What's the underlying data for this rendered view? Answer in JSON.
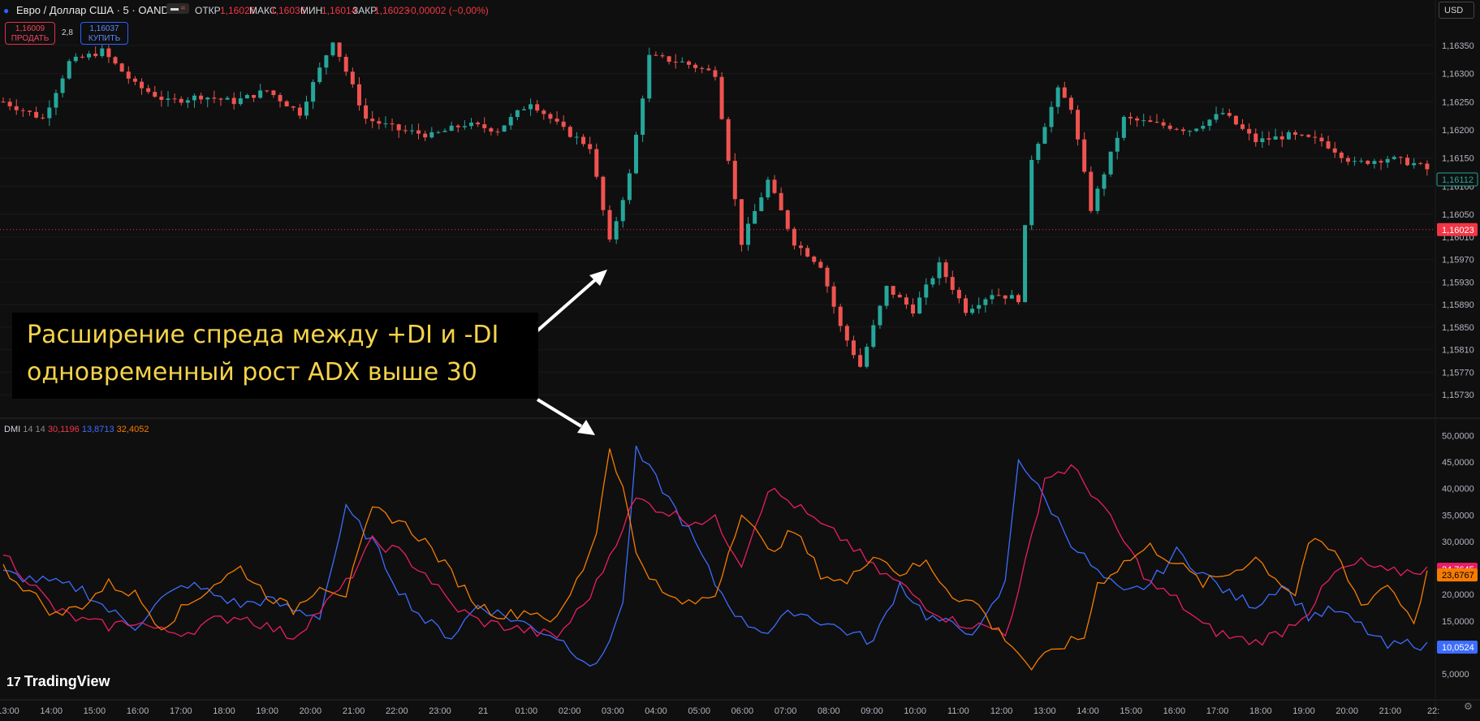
{
  "header": {
    "symbol": "Евро / Доллар США · 5 · OANDA",
    "open_label": "ОТКР",
    "open_value": "1,16026",
    "high_label": "МАКС",
    "high_value": "1,16036",
    "low_label": "МИН",
    "low_value": "1,16014",
    "close_label": "ЗАКР",
    "close_value": "1,16023",
    "change": "−0,00002 (−0,00%)"
  },
  "trade": {
    "sell_price": "1,16009",
    "sell_label": "ПРОДАТЬ",
    "spread": "2,8",
    "buy_price": "1,16037",
    "buy_label": "КУПИТЬ"
  },
  "currency": "USD",
  "annotation": {
    "line1": "Расширение спреда между +DI и -DI",
    "line2": "одновременный рост ADX выше 30"
  },
  "logo": "TradingView",
  "colors": {
    "up": "#26a69a",
    "down": "#ef5350",
    "plus_di": "#3d6cff",
    "minus_di": "#e91e63",
    "adx": "#f57c00",
    "current_price": "#f23645"
  },
  "chart_data": [
    {
      "type": "candlestick",
      "symbol": "EURUSD",
      "interval": "5",
      "x_ticks": [
        "13:00",
        "14:00",
        "15:00",
        "16:00",
        "17:00",
        "18:00",
        "19:00",
        "20:00",
        "21:00",
        "22:00",
        "23:00",
        "21",
        "01:00",
        "02:00",
        "03:00",
        "04:00",
        "05:00",
        "06:00",
        "07:00",
        "08:00",
        "09:00",
        "10:00",
        "11:00",
        "12:00",
        "13:00",
        "14:00",
        "15:00",
        "16:00",
        "17:00",
        "18:00",
        "19:00",
        "20:00",
        "21:00",
        "22:"
      ],
      "y_ticks": [
        "1,16350",
        "1,16300",
        "1,16250",
        "1,16200",
        "1,16150",
        "1,16100",
        "1,16050",
        "1,16010",
        "1,15970",
        "1,15930",
        "1,15890",
        "1,15850",
        "1,15810",
        "1,15770",
        "1,15730"
      ],
      "ylim": [
        1.1571,
        1.1637
      ],
      "price_path": [
        [
          0,
          1.1625
        ],
        [
          6,
          1.1622
        ],
        [
          10,
          1.1632
        ],
        [
          15,
          1.1634
        ],
        [
          20,
          1.1628
        ],
        [
          25,
          1.1625
        ],
        [
          30,
          1.1626
        ],
        [
          35,
          1.1625
        ],
        [
          40,
          1.1627
        ],
        [
          45,
          1.1623
        ],
        [
          50,
          1.1636
        ],
        [
          55,
          1.1622
        ],
        [
          60,
          1.162
        ],
        [
          65,
          1.1619
        ],
        [
          70,
          1.1621
        ],
        [
          75,
          1.162
        ],
        [
          80,
          1.1625
        ],
        [
          85,
          1.162
        ],
        [
          89,
          1.1617
        ],
        [
          92,
          1.16
        ],
        [
          95,
          1.1612
        ],
        [
          98,
          1.1633
        ],
        [
          103,
          1.1632
        ],
        [
          108,
          1.163
        ],
        [
          112,
          1.16
        ],
        [
          116,
          1.1611
        ],
        [
          120,
          1.16
        ],
        [
          124,
          1.1596
        ],
        [
          127,
          1.1585
        ],
        [
          130,
          1.1578
        ],
        [
          134,
          1.1592
        ],
        [
          138,
          1.1588
        ],
        [
          142,
          1.1596
        ],
        [
          146,
          1.1588
        ],
        [
          150,
          1.1591
        ],
        [
          154,
          1.159
        ],
        [
          156,
          1.1615
        ],
        [
          160,
          1.1627
        ],
        [
          162,
          1.1624
        ],
        [
          165,
          1.1606
        ],
        [
          170,
          1.1622
        ],
        [
          175,
          1.1621
        ],
        [
          180,
          1.162
        ],
        [
          185,
          1.1623
        ],
        [
          190,
          1.1618
        ],
        [
          195,
          1.1619
        ],
        [
          200,
          1.1618
        ],
        [
          205,
          1.1614
        ],
        [
          210,
          1.1615
        ],
        [
          214,
          1.1614
        ],
        [
          216,
          1.1613
        ]
      ],
      "last_close": "1,16112",
      "current_price": "1,16023"
    },
    {
      "type": "line",
      "name": "DMI 14 14",
      "legend": {
        "label": "DMI",
        "params": "14 14",
        "adx": "30,1196",
        "plus_di": "13,8713",
        "minus_di": "32,4052"
      },
      "y_ticks": [
        "50,0000",
        "45,0000",
        "40,0000",
        "35,0000",
        "30,0000",
        "25,0000",
        "20,0000",
        "15,0000",
        "5,0000"
      ],
      "ylim": [
        3,
        51
      ],
      "last_values": {
        "minus_di": "24,7645",
        "adx": "23,6767",
        "plus_di": "10,0524"
      },
      "series": [
        {
          "name": "+DI",
          "values": [
            [
              0,
              24
            ],
            [
              8,
              22
            ],
            [
              12,
              21
            ],
            [
              16,
              17
            ],
            [
              20,
              14
            ],
            [
              24,
              19
            ],
            [
              28,
              22
            ],
            [
              32,
              20
            ],
            [
              36,
              18
            ],
            [
              40,
              19
            ],
            [
              44,
              17
            ],
            [
              48,
              16
            ],
            [
              52,
              36
            ],
            [
              56,
              30
            ],
            [
              60,
              21
            ],
            [
              64,
              15
            ],
            [
              68,
              12
            ],
            [
              72,
              18
            ],
            [
              76,
              16
            ],
            [
              80,
              14
            ],
            [
              84,
              12
            ],
            [
              88,
              8
            ],
            [
              90,
              6
            ],
            [
              94,
              18
            ],
            [
              96,
              47
            ],
            [
              100,
              40
            ],
            [
              104,
              32
            ],
            [
              108,
              22
            ],
            [
              112,
              15
            ],
            [
              116,
              13
            ],
            [
              120,
              17
            ],
            [
              124,
              15
            ],
            [
              128,
              13
            ],
            [
              132,
              11
            ],
            [
              136,
              22
            ],
            [
              140,
              16
            ],
            [
              144,
              14
            ],
            [
              148,
              13
            ],
            [
              152,
              22
            ],
            [
              154,
              46
            ],
            [
              158,
              38
            ],
            [
              162,
              30
            ],
            [
              166,
              24
            ],
            [
              170,
              20
            ],
            [
              174,
              22
            ],
            [
              178,
              28
            ],
            [
              182,
              24
            ],
            [
              186,
              20
            ],
            [
              190,
              18
            ],
            [
              194,
              22
            ],
            [
              198,
              16
            ],
            [
              202,
              17
            ],
            [
              206,
              14
            ],
            [
              210,
              10
            ],
            [
              214,
              11
            ],
            [
              216,
              10
            ]
          ]
        },
        {
          "name": "-DI",
          "values": [
            [
              0,
              28
            ],
            [
              8,
              17
            ],
            [
              12,
              15
            ],
            [
              16,
              14
            ],
            [
              20,
              15
            ],
            [
              24,
              13
            ],
            [
              28,
              13
            ],
            [
              32,
              15
            ],
            [
              36,
              16
            ],
            [
              40,
              14
            ],
            [
              44,
              12
            ],
            [
              48,
              17
            ],
            [
              52,
              22
            ],
            [
              56,
              30
            ],
            [
              60,
              28
            ],
            [
              64,
              24
            ],
            [
              68,
              18
            ],
            [
              72,
              15
            ],
            [
              76,
              14
            ],
            [
              80,
              13
            ],
            [
              84,
              12
            ],
            [
              88,
              18
            ],
            [
              90,
              22
            ],
            [
              94,
              33
            ],
            [
              96,
              38
            ],
            [
              100,
              36
            ],
            [
              104,
              34
            ],
            [
              108,
              34
            ],
            [
              112,
              26
            ],
            [
              116,
              40
            ],
            [
              120,
              37
            ],
            [
              124,
              33
            ],
            [
              128,
              30
            ],
            [
              132,
              25
            ],
            [
              136,
              22
            ],
            [
              140,
              18
            ],
            [
              144,
              15
            ],
            [
              148,
              14
            ],
            [
              152,
              13
            ],
            [
              154,
              20
            ],
            [
              158,
              42
            ],
            [
              162,
              44
            ],
            [
              166,
              38
            ],
            [
              170,
              30
            ],
            [
              174,
              22
            ],
            [
              178,
              19
            ],
            [
              182,
              14
            ],
            [
              186,
              12
            ],
            [
              190,
              11
            ],
            [
              194,
              13
            ],
            [
              198,
              17
            ],
            [
              202,
              24
            ],
            [
              206,
              26
            ],
            [
              210,
              24
            ],
            [
              214,
              24.5
            ],
            [
              216,
              24.8
            ]
          ]
        },
        {
          "name": "ADX",
          "values": [
            [
              0,
              25
            ],
            [
              8,
              16
            ],
            [
              12,
              18
            ],
            [
              16,
              22
            ],
            [
              20,
              20
            ],
            [
              24,
              14
            ],
            [
              28,
              18
            ],
            [
              32,
              22
            ],
            [
              36,
              25
            ],
            [
              40,
              20
            ],
            [
              44,
              17
            ],
            [
              48,
              22
            ],
            [
              52,
              20
            ],
            [
              56,
              36
            ],
            [
              60,
              34
            ],
            [
              64,
              30
            ],
            [
              68,
              24
            ],
            [
              72,
              18
            ],
            [
              76,
              16
            ],
            [
              80,
              17
            ],
            [
              84,
              15
            ],
            [
              88,
              25
            ],
            [
              90,
              32
            ],
            [
              92,
              48
            ],
            [
              94,
              40
            ],
            [
              96,
              28
            ],
            [
              100,
              20
            ],
            [
              104,
              18
            ],
            [
              108,
              20
            ],
            [
              112,
              36
            ],
            [
              116,
              28
            ],
            [
              120,
              32
            ],
            [
              124,
              24
            ],
            [
              128,
              22
            ],
            [
              132,
              28
            ],
            [
              136,
              24
            ],
            [
              140,
              26
            ],
            [
              144,
              20
            ],
            [
              148,
              18
            ],
            [
              150,
              14
            ],
            [
              152,
              12
            ],
            [
              154,
              9
            ],
            [
              156,
              6
            ],
            [
              160,
              10
            ],
            [
              164,
              12
            ],
            [
              166,
              22
            ],
            [
              170,
              26
            ],
            [
              174,
              29
            ],
            [
              178,
              26
            ],
            [
              182,
              22
            ],
            [
              186,
              24
            ],
            [
              190,
              27
            ],
            [
              194,
              22
            ],
            [
              196,
              20
            ],
            [
              198,
              30
            ],
            [
              202,
              28
            ],
            [
              206,
              18
            ],
            [
              210,
              22
            ],
            [
              214,
              15
            ],
            [
              216,
              23.7
            ]
          ]
        }
      ]
    }
  ]
}
